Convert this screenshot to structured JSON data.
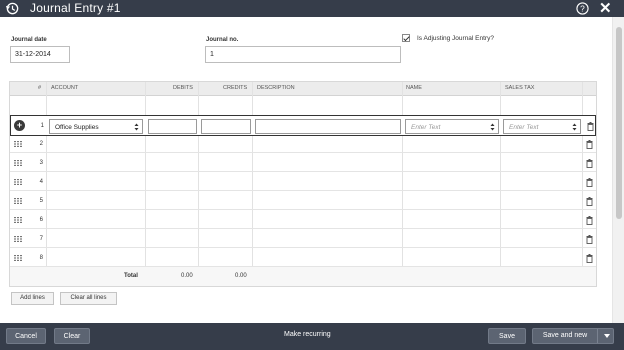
{
  "window": {
    "title": "Journal Entry #1",
    "close_glyph": "✕"
  },
  "icons": {
    "history": "history-icon",
    "help": "help-icon",
    "close": "close-icon"
  },
  "form": {
    "journal_date_label": "Journal date",
    "journal_date_value": "31-12-2014",
    "journal_no_label": "Journal no.",
    "journal_no_value": "1",
    "adjusting_label": "Is Adjusting Journal Entry?",
    "adjusting_checked": true
  },
  "table": {
    "headers": {
      "num": "#",
      "account": "ACCOUNT",
      "debits": "DEBITS",
      "credits": "CREDITS",
      "description": "DESCRIPTION",
      "name": "NAME",
      "sales_tax": "SALES TAX"
    },
    "rows": [
      {
        "num": "1",
        "account": "Office Supplies",
        "name_placeholder": "Enter Text",
        "tax_placeholder": "Enter Text"
      },
      {
        "num": "2"
      },
      {
        "num": "3"
      },
      {
        "num": "4"
      },
      {
        "num": "5"
      },
      {
        "num": "6"
      },
      {
        "num": "7"
      },
      {
        "num": "8"
      }
    ],
    "totals": {
      "label": "Total",
      "debits": "0.00",
      "credits": "0.00"
    }
  },
  "buttons": {
    "add_lines": "Add lines",
    "clear_all_lines": "Clear all lines",
    "cancel": "Cancel",
    "clear": "Clear",
    "make_recurring": "Make recurring",
    "save": "Save",
    "save_and_new": "Save and new"
  },
  "colors": {
    "header_bar": "#363d4a",
    "table_header": "#ececec"
  }
}
